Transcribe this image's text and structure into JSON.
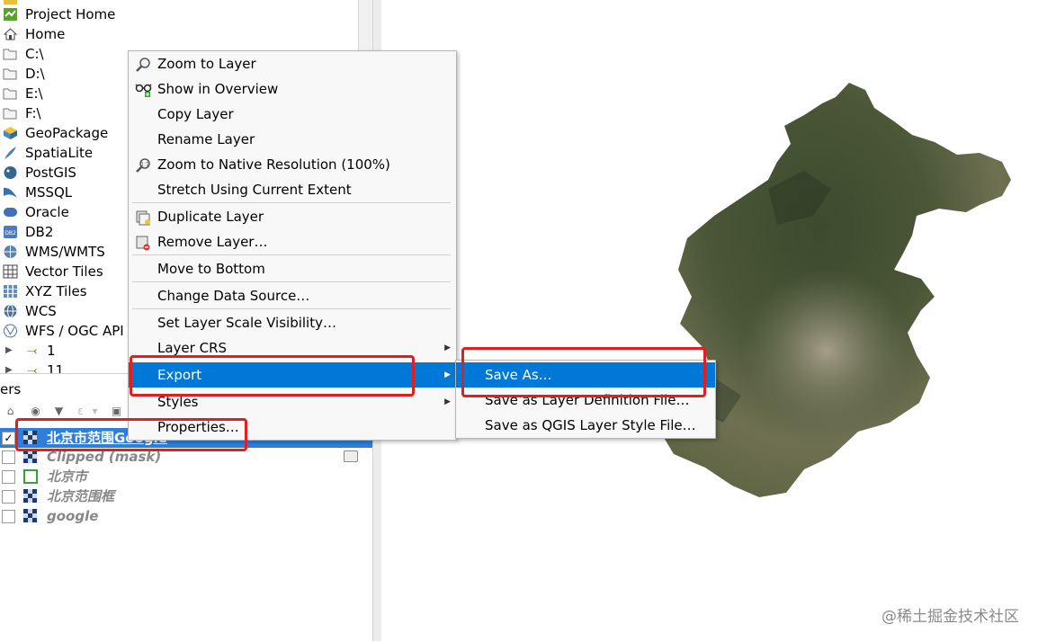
{
  "browser": {
    "items": [
      {
        "label": "Project Home",
        "icon": "project-home-icon"
      },
      {
        "label": "Home",
        "icon": "home-icon"
      },
      {
        "label": "C:\\",
        "icon": "folder-icon"
      },
      {
        "label": "D:\\",
        "icon": "folder-icon"
      },
      {
        "label": "E:\\",
        "icon": "folder-icon"
      },
      {
        "label": "F:\\",
        "icon": "folder-icon"
      },
      {
        "label": "GeoPackage",
        "icon": "geopackage-icon"
      },
      {
        "label": "SpatiaLite",
        "icon": "spatialite-icon"
      },
      {
        "label": "PostGIS",
        "icon": "postgis-icon"
      },
      {
        "label": "MSSQL",
        "icon": "mssql-icon"
      },
      {
        "label": "Oracle",
        "icon": "oracle-icon"
      },
      {
        "label": "DB2",
        "icon": "db2-icon"
      },
      {
        "label": "WMS/WMTS",
        "icon": "wms-icon"
      },
      {
        "label": "Vector Tiles",
        "icon": "vector-tiles-icon"
      },
      {
        "label": "XYZ Tiles",
        "icon": "xyz-tiles-icon"
      },
      {
        "label": "WCS",
        "icon": "wcs-icon"
      },
      {
        "label": "WFS / OGC API -",
        "icon": "wfs-icon"
      }
    ],
    "tile_items": [
      {
        "label": "1"
      },
      {
        "label": "11"
      }
    ]
  },
  "layers_panel": {
    "title": "ers",
    "layers": [
      {
        "label": "北京市范围Google",
        "checked": true,
        "selected": true,
        "check_mark": "✓"
      },
      {
        "label": "Clipped (mask)",
        "checked": false,
        "selected": false
      },
      {
        "label": "北京市",
        "checked": false,
        "selected": false
      },
      {
        "label": "北京范围框",
        "checked": false,
        "selected": false
      },
      {
        "label": "google",
        "checked": false,
        "selected": false
      }
    ]
  },
  "context_menu": {
    "zoom_to_layer": "Zoom to Layer",
    "show_in_overview": "Show in Overview",
    "copy_layer": "Copy Layer",
    "rename_layer": "Rename Layer",
    "zoom_native": "Zoom to Native Resolution (100%)",
    "stretch": "Stretch Using Current Extent",
    "duplicate_layer": "Duplicate Layer",
    "remove_layer": "Remove Layer…",
    "move_to_bottom": "Move to Bottom",
    "change_data_source": "Change Data Source…",
    "set_scale_visibility": "Set Layer Scale Visibility…",
    "layer_crs": "Layer CRS",
    "export": "Export",
    "styles": "Styles",
    "properties": "Properties…"
  },
  "export_submenu": {
    "save_as": "Save As…",
    "save_layer_definition": "Save as Layer Definition File…",
    "save_qgis_style": "Save as QGIS Layer Style File…"
  },
  "watermark": "@稀土掘金技术社区",
  "colors": {
    "highlight": "#0078d7",
    "selected_layer": "#2f7ed8",
    "annotation_red": "#e02020"
  }
}
